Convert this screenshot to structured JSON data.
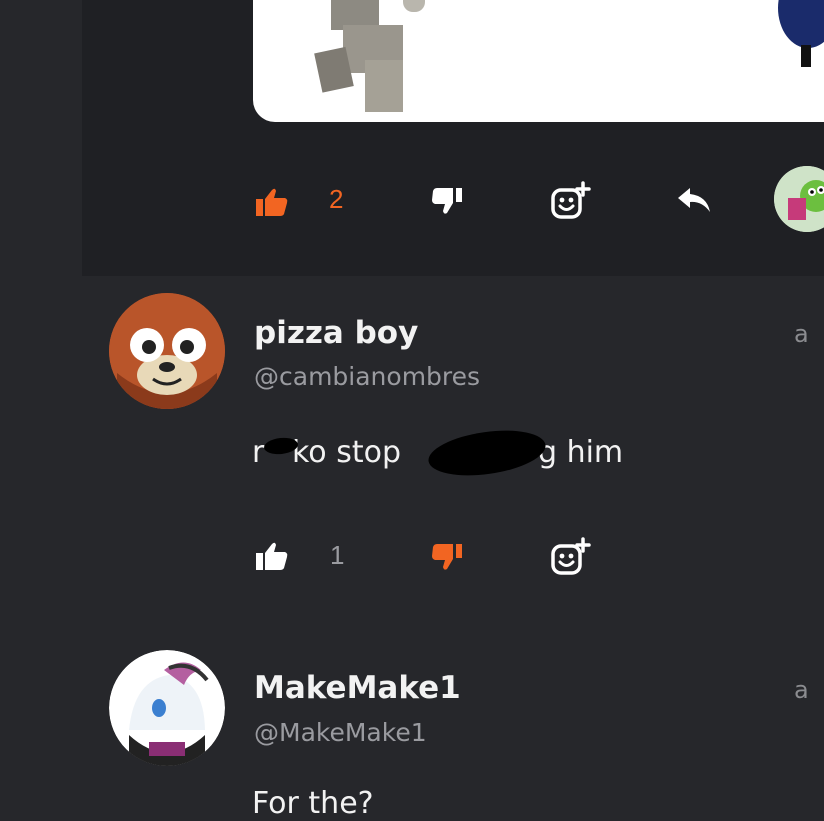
{
  "colors": {
    "accent": "#f26522",
    "background": "#26272b",
    "card": "#1f2024",
    "muted": "#9a9ba0"
  },
  "post": {
    "upvote_count": "2",
    "icons": [
      "thumbs-up-icon",
      "thumbs-down-icon",
      "add-reaction-icon",
      "reply-icon"
    ]
  },
  "comments": [
    {
      "username": "pizza boy",
      "handle": "@cambianombres",
      "time": "a",
      "text_before": "r",
      "text_mid": "ko stop",
      "text_after": "g him",
      "like_count": "1"
    },
    {
      "username": "MakeMake1",
      "handle": "@MakeMake1",
      "time": "a",
      "text": "For the?"
    }
  ]
}
